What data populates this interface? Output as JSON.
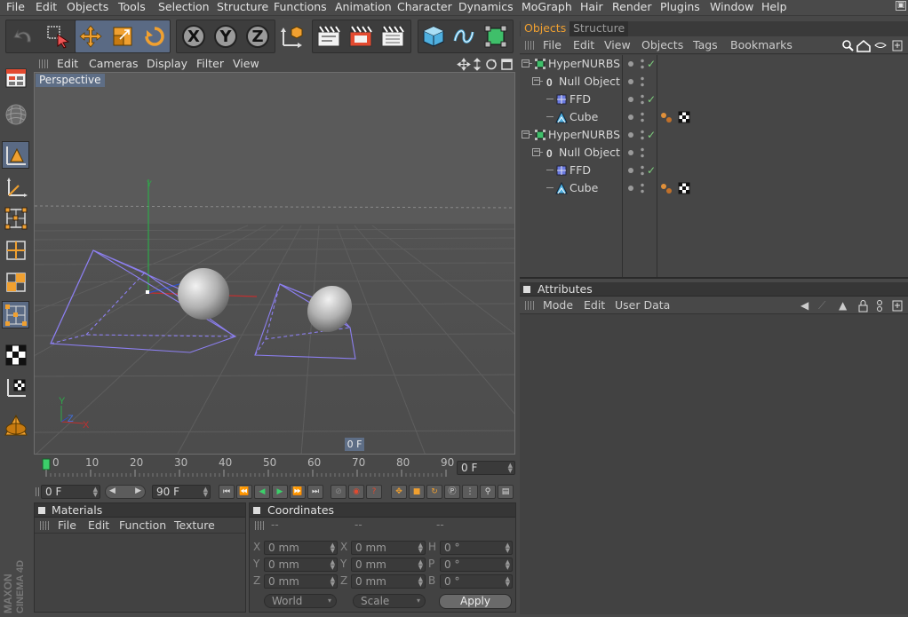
{
  "menu": [
    "File",
    "Edit",
    "Objects",
    "Tools",
    "Selection",
    "Structure",
    "Functions",
    "Animation",
    "Character",
    "Dynamics",
    "MoGraph",
    "Hair",
    "Render",
    "Plugins",
    "Window",
    "Help"
  ],
  "viewport": {
    "menu": [
      "Edit",
      "Cameras",
      "Display",
      "Filter",
      "View"
    ],
    "label": "Perspective",
    "frame_label": "0 F"
  },
  "timeline": {
    "ticks": [
      "0",
      "10",
      "20",
      "30",
      "40",
      "50",
      "60",
      "70",
      "80",
      "90"
    ],
    "current_frame": "0 F"
  },
  "playback": {
    "start": "0 F",
    "end": "90 F"
  },
  "materials": {
    "title": "Materials",
    "menu": [
      "File",
      "Edit",
      "Function",
      "Texture"
    ]
  },
  "coordinates": {
    "title": "Coordinates",
    "col_headers": [
      "--",
      "--",
      "--"
    ],
    "rows": [
      {
        "a": "X",
        "av": "0 mm",
        "b": "X",
        "bv": "0 mm",
        "c": "H",
        "cv": "0 °"
      },
      {
        "a": "Y",
        "av": "0 mm",
        "b": "Y",
        "bv": "0 mm",
        "c": "P",
        "cv": "0 °"
      },
      {
        "a": "Z",
        "av": "0 mm",
        "b": "Z",
        "bv": "0 mm",
        "c": "B",
        "cv": "0 °"
      }
    ],
    "mode1": "World",
    "mode2": "Scale",
    "apply": "Apply"
  },
  "objects_panel": {
    "tabs": [
      "Objects",
      "Structure"
    ],
    "menu": [
      "File",
      "Edit",
      "View",
      "Objects",
      "Tags",
      "Bookmarks"
    ],
    "tree": [
      {
        "name": "HyperNURBS",
        "depth": 0,
        "icon": "hypernurbs-icon",
        "check": true,
        "tags": false
      },
      {
        "name": "Null Object",
        "depth": 1,
        "icon": "null-object-icon",
        "check": false,
        "tags": false
      },
      {
        "name": "FFD",
        "depth": 2,
        "icon": "ffd-icon",
        "check": true,
        "tags": false
      },
      {
        "name": "Cube",
        "depth": 2,
        "icon": "cube-icon",
        "check": false,
        "tags": true
      },
      {
        "name": "HyperNURBS",
        "depth": 0,
        "icon": "hypernurbs-icon",
        "check": true,
        "tags": false
      },
      {
        "name": "Null Object",
        "depth": 1,
        "icon": "null-object-icon",
        "check": false,
        "tags": false
      },
      {
        "name": "FFD",
        "depth": 2,
        "icon": "ffd-icon",
        "check": true,
        "tags": false
      },
      {
        "name": "Cube",
        "depth": 2,
        "icon": "cube-icon",
        "check": false,
        "tags": true
      }
    ]
  },
  "attributes_panel": {
    "title": "Attributes",
    "menu": [
      "Mode",
      "Edit",
      "User Data"
    ]
  },
  "logo": {
    "line1": "MAXON",
    "line2": "CINEMA 4D"
  },
  "colors": {
    "accent": "#e8a23a",
    "selection": "#5e6e86",
    "wire": "#8c7ff0"
  }
}
